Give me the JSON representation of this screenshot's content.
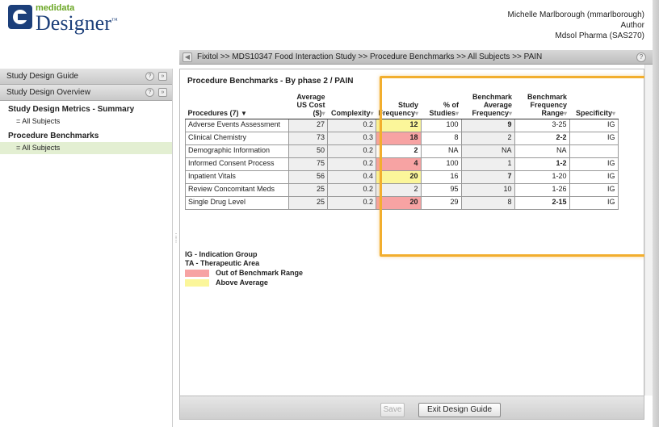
{
  "brand": {
    "small": "medidata",
    "big": "Designer",
    "mark": "™"
  },
  "user": {
    "name": "Michelle Marlborough (mmarlborough)",
    "role": "Author",
    "company": "Mdsol Pharma (SAS270)"
  },
  "breadcrumb": "Fixitol >> MDS10347 Food Interaction Study >> Procedure Benchmarks >> All Subjects >> PAIN",
  "sidebar": {
    "header1": "Study Design Guide",
    "header2": "Study Design Overview",
    "section1": "Study Design Metrics - Summary",
    "section1_item": "= All Subjects",
    "section2": "Procedure Benchmarks",
    "section2_item": "= All Subjects"
  },
  "panel_title": "Procedure Benchmarks - By phase 2 / PAIN",
  "table": {
    "headers": {
      "procedures": "Procedures (7)",
      "cost_1": "Average",
      "cost_2": "US Cost",
      "cost_3": "($)",
      "complexity": "Complexity",
      "freq_1": "Study",
      "freq_2": "Frequency",
      "pct_1": "% of",
      "pct_2": "Studies",
      "bavg_1": "Benchmark",
      "bavg_2": "Average",
      "bavg_3": "Frequency",
      "brange_1": "Benchmark",
      "brange_2": "Frequency",
      "brange_3": "Range",
      "specificity": "Specificity"
    },
    "rows": [
      {
        "proc": "Adverse Events Assessment",
        "cost": "27",
        "complexity": "0.2",
        "freq": "12",
        "pct": "100",
        "bavg": "9",
        "brange": "3-25",
        "spec": "IG"
      },
      {
        "proc": "Clinical Chemistry",
        "cost": "73",
        "complexity": "0.3",
        "freq": "18",
        "pct": "8",
        "bavg": "2",
        "brange": "2-2",
        "spec": "IG"
      },
      {
        "proc": "Demographic Information",
        "cost": "50",
        "complexity": "0.2",
        "freq": "2",
        "pct": "NA",
        "bavg": "NA",
        "brange": "NA",
        "spec": ""
      },
      {
        "proc": "Informed Consent Process",
        "cost": "75",
        "complexity": "0.2",
        "freq": "4",
        "pct": "100",
        "bavg": "1",
        "brange": "1-2",
        "spec": "IG"
      },
      {
        "proc": "Inpatient Vitals",
        "cost": "56",
        "complexity": "0.4",
        "freq": "20",
        "pct": "16",
        "bavg": "7",
        "brange": "1-20",
        "spec": "IG"
      },
      {
        "proc": "Review Concomitant Meds",
        "cost": "25",
        "complexity": "0.2",
        "freq": "2",
        "pct": "95",
        "bavg": "10",
        "brange": "1-26",
        "spec": "IG"
      },
      {
        "proc": "Single Drug Level",
        "cost": "25",
        "complexity": "0.2",
        "freq": "20",
        "pct": "29",
        "bavg": "8",
        "brange": "2-15",
        "spec": "IG"
      }
    ]
  },
  "legend": {
    "ig": "IG - Indication Group",
    "ta": "TA - Therapeutic Area",
    "out_range": "Out of Benchmark Range",
    "above_avg": "Above Average"
  },
  "colors": {
    "out_range": "#f7a3a3",
    "above_avg": "#fbf69a",
    "highlight": "#f2ae2e"
  },
  "buttons": {
    "save": "Save",
    "exit": "Exit Design Guide"
  }
}
